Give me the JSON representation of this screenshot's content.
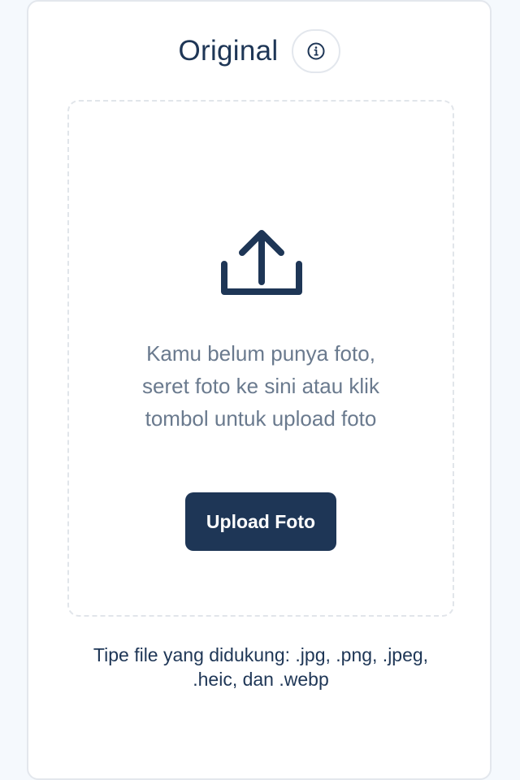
{
  "header": {
    "title": "Original",
    "info_icon": "info-icon"
  },
  "dropzone": {
    "upload_icon": "upload-icon",
    "message": "Kamu belum punya foto, seret foto ke sini atau klik tombol untuk upload foto",
    "button_label": "Upload Foto"
  },
  "footer": {
    "supported_types": "Tipe file yang didukung: .jpg, .png, .jpeg, .heic, dan .webp"
  },
  "colors": {
    "primary": "#1e3656",
    "muted_text": "#6a7a8e",
    "border": "#e3e7ed",
    "page_bg": "#f5f9fd"
  }
}
